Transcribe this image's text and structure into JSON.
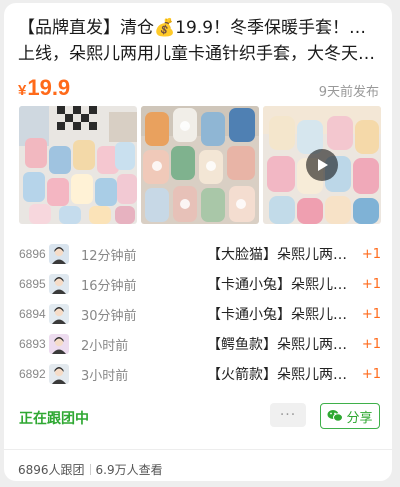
{
  "post": {
    "title_line1": "【品牌直发】清仓💰19.9！冬季保暖手套！全新",
    "title_line2": "上线，朵熙儿两用儿童卡通针织手套，大冬天…",
    "price_symbol": "¥",
    "price_value": "19.9",
    "posted_time": "9天前发布"
  },
  "photos": [
    {
      "icon": "gloves-photo",
      "has_video": false
    },
    {
      "icon": "gloves-photo",
      "has_video": false
    },
    {
      "icon": "gloves-photo",
      "has_video": true
    }
  ],
  "orders": [
    {
      "num": "6896",
      "time": "12分钟前",
      "item": "【大脸猫】朵熙儿两用儿童卡通针织手套",
      "qty": "+1",
      "avatar_color": "#d9e4ee"
    },
    {
      "num": "6895",
      "time": "16分钟前",
      "item": "【卡通小兔】朵熙儿两用儿童卡通针织手套",
      "qty": "+1",
      "avatar_color": "#dfe8ef"
    },
    {
      "num": "6894",
      "time": "30分钟前",
      "item": "【卡通小兔】朵熙儿两用儿童卡通针织手套",
      "qty": "+1",
      "avatar_color": "#e2eaf0"
    },
    {
      "num": "6893",
      "time": "2小时前",
      "item": "【鳄鱼款】朵熙儿两用儿童卡通针织手套",
      "qty": "+1",
      "avatar_color": "#eddcef"
    },
    {
      "num": "6892",
      "time": "3小时前",
      "item": "【火箭款】朵熙儿两用儿童卡通针织手套",
      "qty": "+1",
      "avatar_color": "#e3e9ee"
    }
  ],
  "actions": {
    "status_label": "正在跟团中",
    "more_label": "···",
    "share_label": "分享"
  },
  "footer": {
    "followers": "6896人跟团",
    "views": "6.9万人查看"
  },
  "colors": {
    "accent_orange": "#ff6a1a",
    "accent_green": "#2fa832"
  }
}
